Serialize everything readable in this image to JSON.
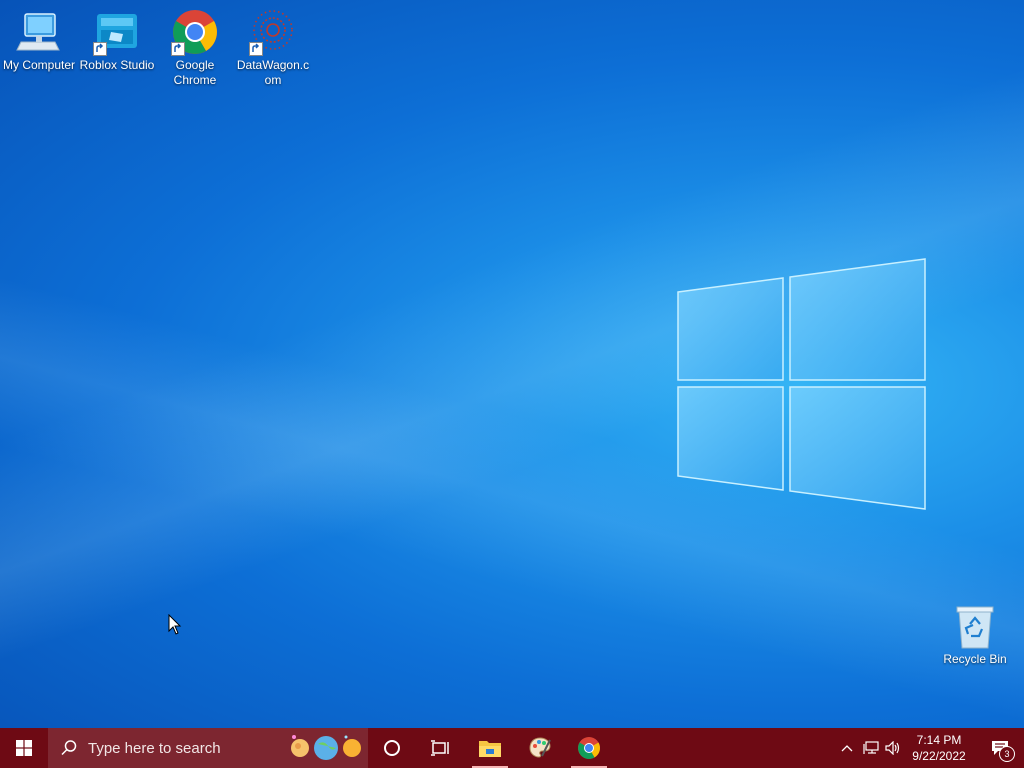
{
  "desktop": {
    "icons": [
      {
        "label": "My Computer",
        "icon": "computer-icon"
      },
      {
        "label": "Roblox Studio",
        "icon": "roblox-studio-icon"
      },
      {
        "label": "Google Chrome",
        "icon": "chrome-icon"
      },
      {
        "label": "DataWagon.com",
        "icon": "datawagon-icon"
      },
      {
        "label": "Recycle Bin",
        "icon": "recycle-bin-icon"
      }
    ]
  },
  "taskbar": {
    "search_placeholder": "Type here to search",
    "pinned": [
      "file-explorer-icon",
      "paint-icon",
      "chrome-icon"
    ],
    "clock_time": "7:14 PM",
    "clock_date": "9/22/2022",
    "notification_count": "3",
    "colors": {
      "taskbar": "#6e0a14",
      "search": "#7d2630",
      "accent": "#f7b5b5"
    }
  }
}
